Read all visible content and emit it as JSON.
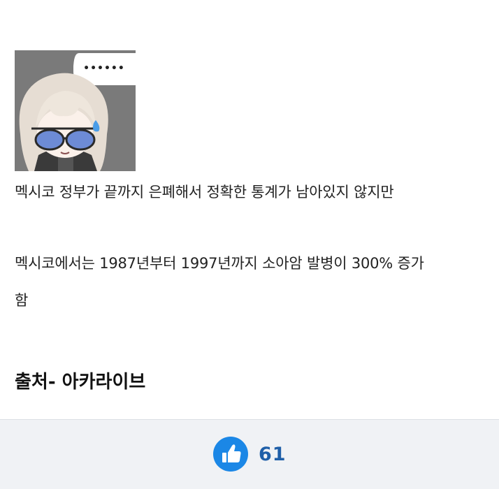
{
  "post": {
    "sticker_icon": "chibi-character-sweat-sticker",
    "speech_bubble_text": "••••••",
    "paragraph_1": "멕시코 정부가 끝까지 은폐해서 정확한 통계가 남아있지 않지만",
    "paragraph_2_line_1": "멕시코에서는 1987년부터 1997년까지 소아암 발병이 300% 증가",
    "paragraph_2_line_2": "함",
    "source": "출처- 아카라이브"
  },
  "footer": {
    "like_icon": "thumbs-up-icon",
    "like_count": "61",
    "accent_color": "#1b87e6",
    "count_color": "#1f5fa8"
  }
}
